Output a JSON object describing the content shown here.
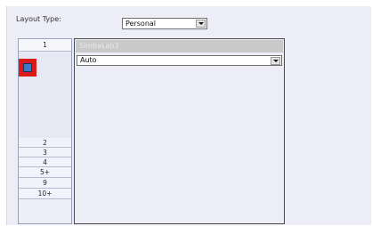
{
  "layout": {
    "label": "Layout Type:",
    "selected": "Personal"
  },
  "tabs": [
    "1",
    "2",
    "3",
    "4",
    "5+",
    "9",
    "10+"
  ],
  "selected_tab": "1",
  "swatch": {
    "outer_color": "#dd1a1a",
    "inner_color": "#3f7ac9"
  },
  "content": {
    "header": "SimbaLab3",
    "dropdown_value": "Auto"
  }
}
